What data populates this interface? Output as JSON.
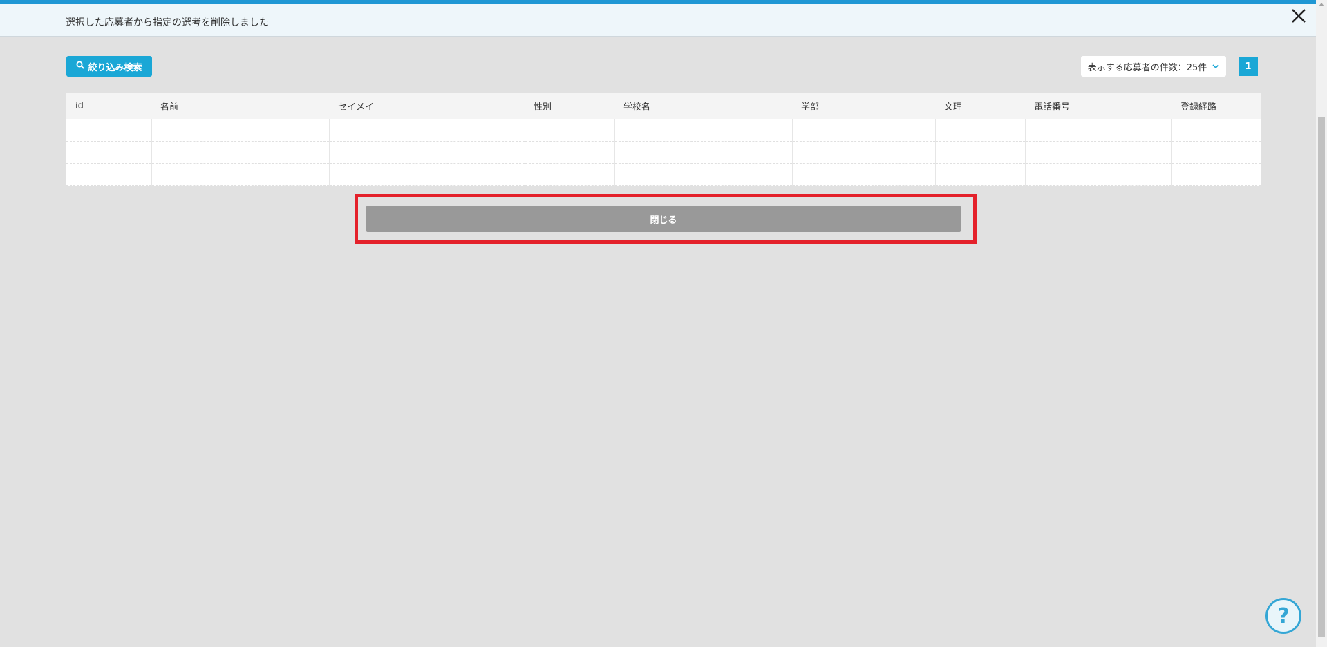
{
  "message": {
    "text": "選択した応募者から指定の選考を削除しました"
  },
  "icons": {
    "close": "close-x-icon",
    "search": "search-icon",
    "chevron": "chevron-down-icon",
    "help": "help-icon"
  },
  "toolbar": {
    "filter_label": "絞り込み検索",
    "count_select_label": "表示する応募者の件数：25件",
    "page_number": "1"
  },
  "table": {
    "headers": [
      "id",
      "名前",
      "セイメイ",
      "性別",
      "学校名",
      "学部",
      "文理",
      "電話番号",
      "登録経路"
    ],
    "rows": [
      [
        "",
        "",
        "",
        "",
        "",
        "",
        "",
        "",
        ""
      ],
      [
        "",
        "",
        "",
        "",
        "",
        "",
        "",
        "",
        ""
      ],
      [
        "",
        "",
        "",
        "",
        "",
        "",
        "",
        "",
        ""
      ]
    ]
  },
  "footer": {
    "close_label": "閉じる"
  },
  "help": {
    "label": "?"
  },
  "colors": {
    "accent": "#1aa7d6",
    "top_stripe": "#1f97d4",
    "highlight": "#e4212b",
    "close_button": "#999999"
  }
}
